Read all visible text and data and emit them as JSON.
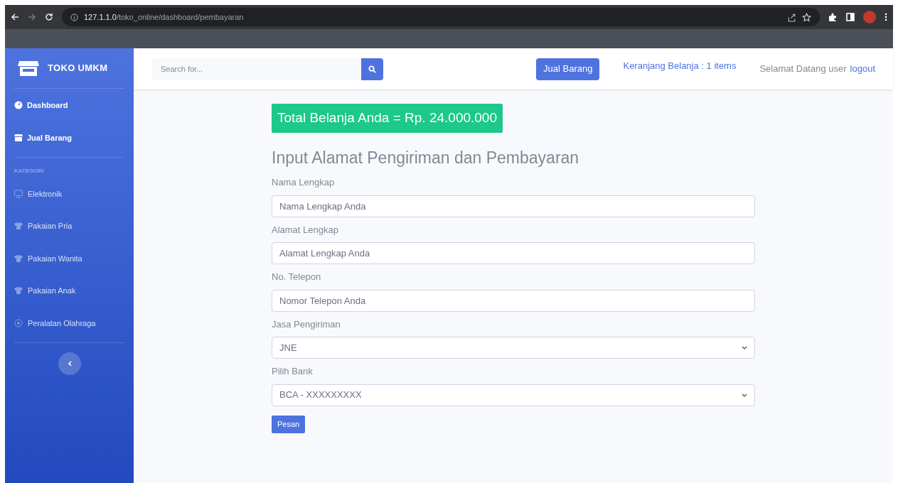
{
  "browser": {
    "url_host": "127.1.1.0",
    "url_path": "/toko_online/dashboard/pembayaran"
  },
  "sidebar": {
    "brand": "TOKO UMKM",
    "main_items": [
      {
        "label": "Dashboard"
      },
      {
        "label": "Jual Barang"
      }
    ],
    "section_heading": "KATEGORI",
    "categories": [
      {
        "label": "Elektronik"
      },
      {
        "label": "Pakaian Pria"
      },
      {
        "label": "Pakaian Wanita"
      },
      {
        "label": "Pakaian Anak"
      },
      {
        "label": "Peralatan Olahraga"
      }
    ]
  },
  "topbar": {
    "search": {
      "placeholder": "Search for..."
    },
    "sell_button": "Jual Barang",
    "cart_link": "Keranjang Belanja : 1 items",
    "greeting": "Selamat Datang user",
    "logout_link": "logout"
  },
  "main": {
    "total_banner": "Total Belanja Anda = Rp. 24.000.000",
    "heading": "Input Alamat Pengiriman dan Pembayaran",
    "fields": [
      {
        "kind": "text",
        "label": "Nama Lengkap",
        "placeholder": "Nama Lengkap Anda"
      },
      {
        "kind": "text",
        "label": "Alamat Lengkap",
        "placeholder": "Alamat Lengkap Anda"
      },
      {
        "kind": "text",
        "label": "No. Telepon",
        "placeholder": "Nomor Telepon Anda"
      },
      {
        "kind": "select",
        "label": "Jasa Pengiriman",
        "value": "JNE"
      },
      {
        "kind": "select",
        "label": "Pilih Bank",
        "value": "BCA - XXXXXXXXX"
      }
    ],
    "submit_button": "Pesan"
  }
}
